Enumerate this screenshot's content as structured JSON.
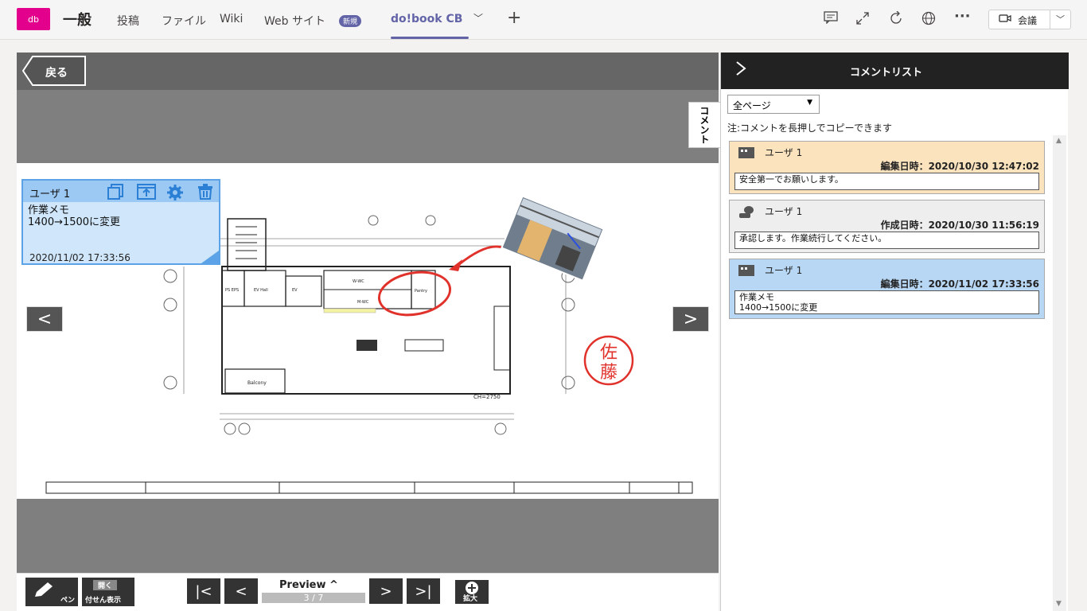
{
  "topbar": {
    "app_icon": "db",
    "channel_title": "一般",
    "tabs": [
      {
        "label": "投稿"
      },
      {
        "label": "ファイル"
      },
      {
        "label": "Wiki"
      },
      {
        "label": "Web サイト"
      },
      {
        "label": "do!book CB"
      }
    ],
    "new_badge": "新規",
    "add_tab": "+",
    "meet_label": "会議",
    "icons": [
      "chat-icon",
      "popout-icon",
      "refresh-icon",
      "globe-icon",
      "more-icon"
    ]
  },
  "viewer": {
    "back_label": "戻る",
    "prev_arrow": "<",
    "next_arrow": ">",
    "memo": {
      "user": "ユーザ 1",
      "body": "作業メモ\n1400→1500に変更",
      "date": "2020/11/02 17:33:56"
    },
    "stamp_text": "佐藤",
    "drawing_label": "CH=2750",
    "toolbar": {
      "pen_label": "ペン",
      "open_label": "開く",
      "sticky_label": "付せん表示",
      "preview_label": "Preview ^",
      "page_indicator": "3 / 7",
      "zoom_label": "拡大"
    }
  },
  "panel": {
    "title": "コメントリスト",
    "side_tab": "コメント",
    "filter_value": "全ページ",
    "note": "注:コメントを長押しでコピーできます",
    "comments": [
      {
        "user": "ユーザ 1",
        "timestamp": "編集日時：2020/10/30 12:47:02",
        "text": "安全第一でお願いします。",
        "bg": "#fbe3bd"
      },
      {
        "user": "ユーザ 1",
        "timestamp": "作成日時：2020/10/30 11:56:19",
        "text": "承認します。作業続行してください。",
        "bg": "#eeeeee"
      },
      {
        "user": "ユーザ 1",
        "timestamp": "編集日時：2020/11/02 17:33:56",
        "text": "作業メモ\n1400→1500に変更",
        "bg": "#b8d7f4"
      }
    ]
  }
}
